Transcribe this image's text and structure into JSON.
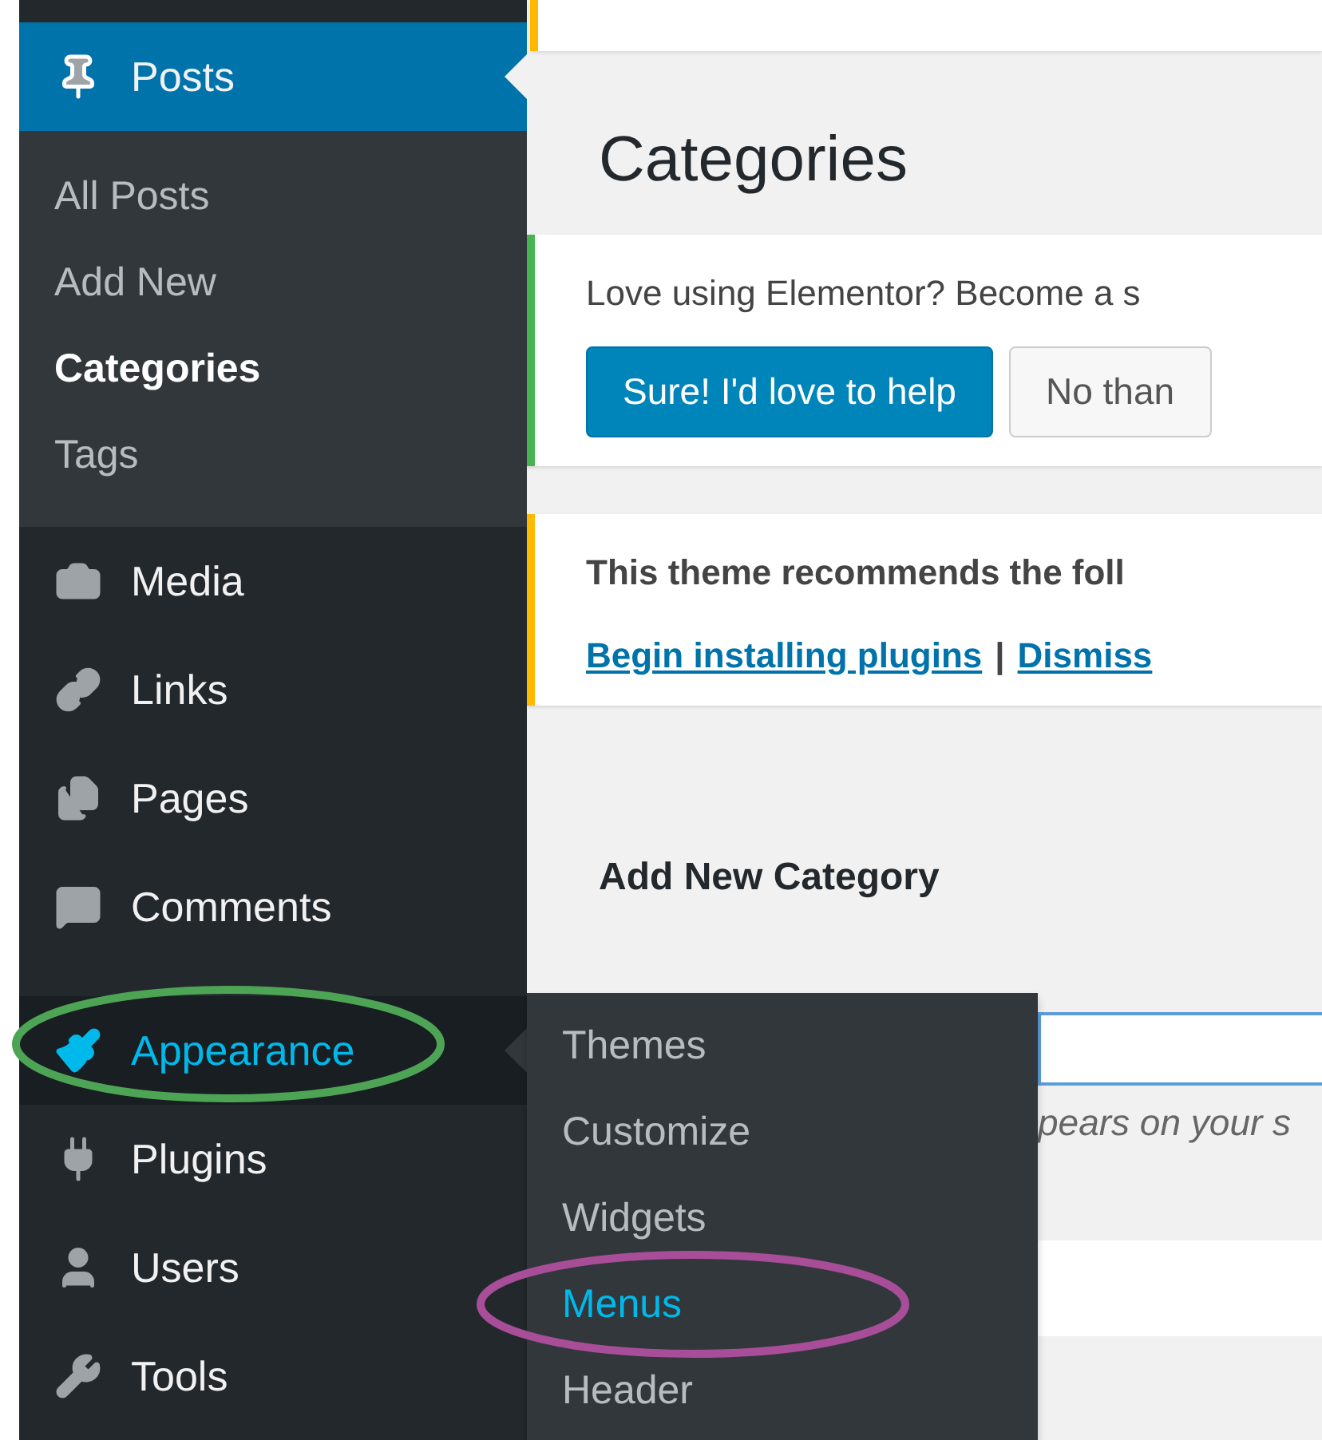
{
  "sidebar": {
    "items": [
      {
        "kind": "item",
        "label": "Posts",
        "selected": true,
        "submenu": [
          {
            "label": "All Posts",
            "selected": false
          },
          {
            "label": "Add New",
            "selected": false
          },
          {
            "label": "Categories",
            "selected": true
          },
          {
            "label": "Tags",
            "selected": false
          }
        ]
      },
      {
        "kind": "item",
        "label": "Media",
        "selected": false
      },
      {
        "kind": "item",
        "label": "Links",
        "selected": false
      },
      {
        "kind": "item",
        "label": "Pages",
        "selected": false
      },
      {
        "kind": "item",
        "label": "Comments",
        "selected": false
      },
      {
        "kind": "separator"
      },
      {
        "kind": "item",
        "label": "Appearance",
        "selected": false,
        "hovered": true,
        "annotation": {
          "kind": "ellipse",
          "color": "#4ea455"
        },
        "flyout": [
          {
            "label": "Themes",
            "selected": false
          },
          {
            "label": "Customize",
            "selected": false
          },
          {
            "label": "Widgets",
            "selected": false
          },
          {
            "label": "Menus",
            "selected": true,
            "annotation": {
              "kind": "ellipse",
              "color": "#a84e98"
            }
          },
          {
            "label": "Header",
            "selected": false
          }
        ]
      },
      {
        "kind": "item",
        "label": "Plugins",
        "selected": false
      },
      {
        "kind": "item",
        "label": "Users",
        "selected": false
      },
      {
        "kind": "item",
        "label": "Tools",
        "selected": false
      }
    ]
  },
  "content": {
    "title": "Categories",
    "notices": [
      {
        "color": "#46b450",
        "text": "Love using Elementor? Become a s",
        "buttons": [
          {
            "label": "Sure! I'd love to help",
            "primary": true
          },
          {
            "label": "No than",
            "primary": false
          }
        ]
      },
      {
        "color": "#ffb900",
        "text": "This theme recommends the foll",
        "links": [
          "Begin installing plugins",
          "Dismiss"
        ],
        "link_separator": "|"
      }
    ],
    "form": {
      "heading": "Add New Category",
      "description": "pears on your s"
    }
  }
}
